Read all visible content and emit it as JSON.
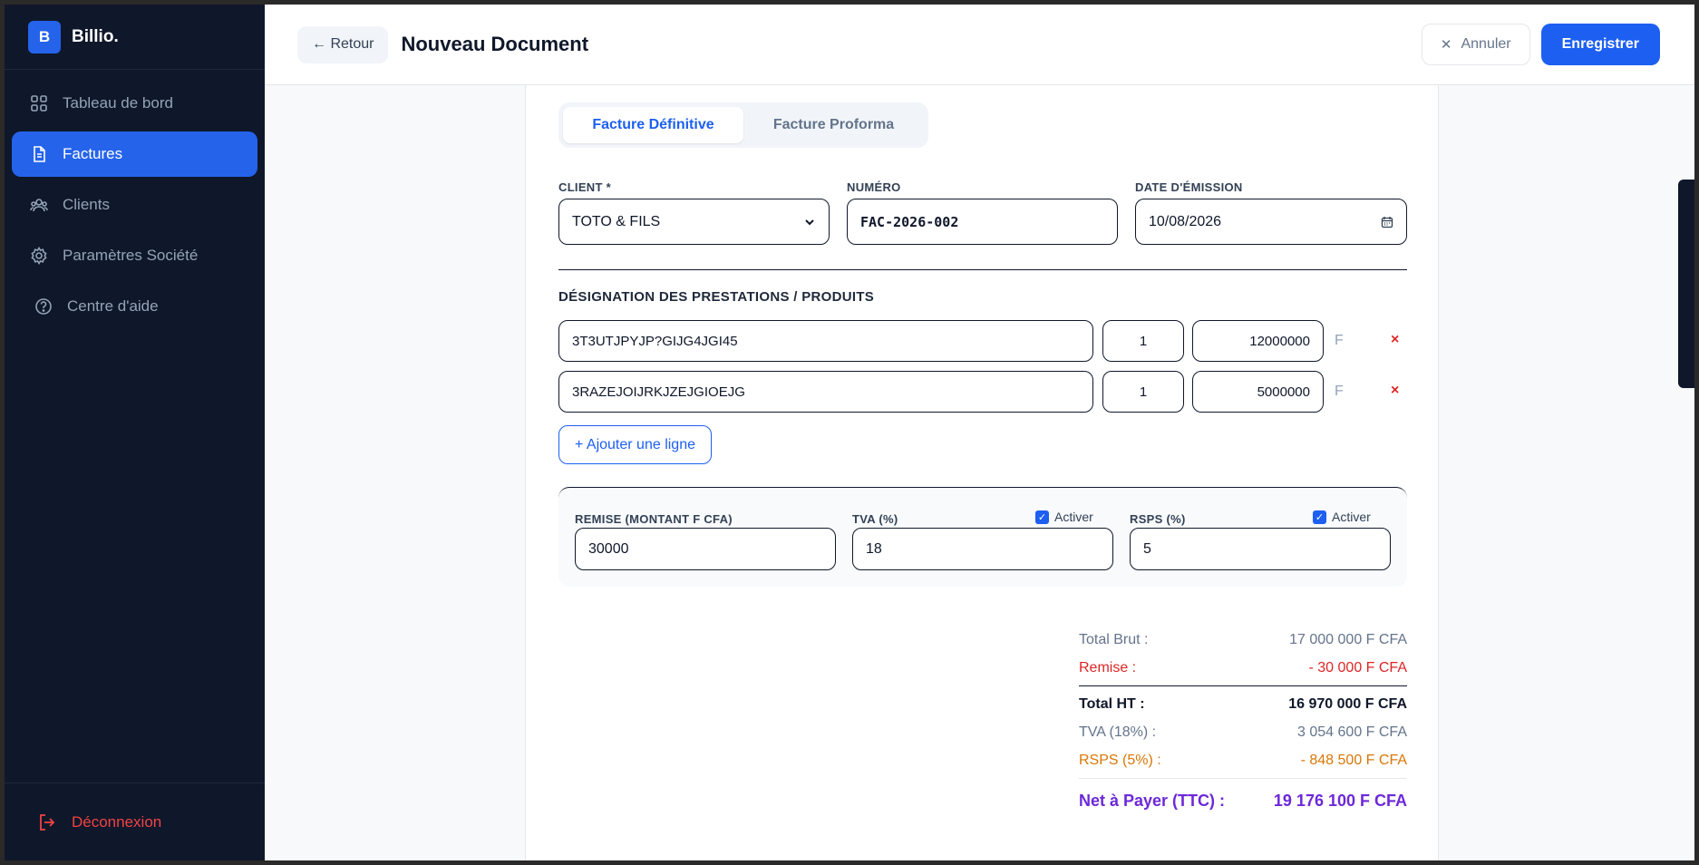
{
  "brand": {
    "logo_letter": "B",
    "name": "Billio."
  },
  "sidebar": {
    "items": [
      {
        "label": "Tableau de bord",
        "icon": "grid-icon",
        "active": false
      },
      {
        "label": "Factures",
        "icon": "document-icon",
        "active": true
      },
      {
        "label": "Clients",
        "icon": "users-icon",
        "active": false
      },
      {
        "label": "Paramètres Société",
        "icon": "gear-icon",
        "active": false
      },
      {
        "label": "Centre d'aide",
        "icon": "help-circle-icon",
        "active": false
      }
    ],
    "logout_label": "Déconnexion"
  },
  "header": {
    "back_label": "← Retour",
    "title": "Nouveau Document",
    "cancel_label": "Annuler",
    "save_label": "Enregistrer"
  },
  "doc_type": {
    "options": [
      "Facture Définitive",
      "Facture Proforma"
    ],
    "selected": "Facture Définitive"
  },
  "form": {
    "client_label": "CLIENT *",
    "client_value": "TOTO & FILS",
    "numero_label": "NUMÉRO",
    "numero_value": "FAC-2026-002",
    "date_label": "DATE D'ÉMISSION",
    "date_value": "10/08/2026"
  },
  "lines": {
    "title": "DÉSIGNATION DES PRESTATIONS / PRODUITS",
    "unit": "F",
    "remove_symbol": "×",
    "items": [
      {
        "designation": "3T3UTJPYJP?GIJG4JGI45",
        "qty": "1",
        "price": "12000000"
      },
      {
        "designation": "3RAZEJOIJRKJZEJGIOEJG",
        "qty": "1",
        "price": "5000000"
      }
    ],
    "add_label": "+ Ajouter une ligne"
  },
  "adjustments": {
    "remise_label": "REMISE (MONTANT F CFA)",
    "remise_value": "30000",
    "tva_label": "TVA (%)",
    "tva_value": "18",
    "tva_active_label": "Activer",
    "rsps_label": "RSPS (%)",
    "rsps_value": "5",
    "rsps_active_label": "Activer"
  },
  "totals": {
    "brut_label": "Total Brut :",
    "brut_value": "17 000 000 F CFA",
    "remise_label": "Remise :",
    "remise_value": "- 30 000 F CFA",
    "ht_label": "Total HT :",
    "ht_value": "16 970 000 F CFA",
    "tva_label": "TVA (18%) :",
    "tva_value": "3 054 600 F CFA",
    "rsps_label": "RSPS (5%) :",
    "rsps_value": "- 848 500 F CFA",
    "net_label": "Net à Payer (TTC) :",
    "net_value": "19 176 100 F CFA"
  },
  "colors": {
    "accent": "#1d5ff0",
    "sidebar_bg": "#0f172a",
    "danger": "#dc2626",
    "net": "#6d28d9",
    "rsps": "#d97706"
  }
}
